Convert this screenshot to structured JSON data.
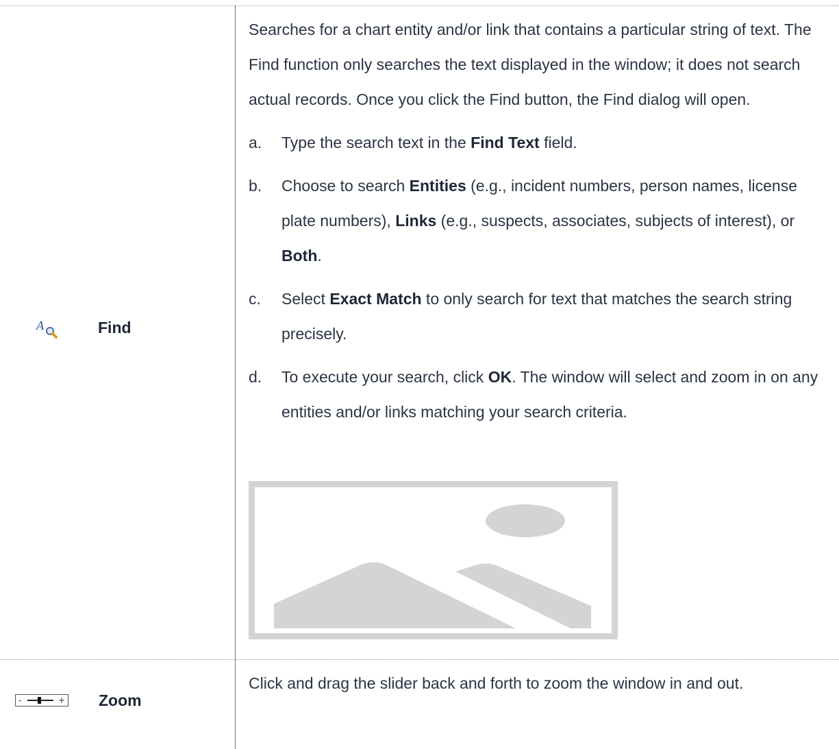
{
  "rows": [
    {
      "icon": "find-magnifier-icon",
      "label": "Find",
      "intro": "Searches for a chart entity and/or link that contains a particular string of text. The Find function only searches the text displayed in the window; it does not search actual records. Once you click the Find button, the Find dialog will open.",
      "steps": [
        {
          "marker": "a.",
          "parts": [
            {
              "t": "Type the search text in the ",
              "b": false
            },
            {
              "t": "Find Text",
              "b": true
            },
            {
              "t": " field.",
              "b": false
            }
          ]
        },
        {
          "marker": "b.",
          "parts": [
            {
              "t": "Choose to search ",
              "b": false
            },
            {
              "t": "Entities",
              "b": true
            },
            {
              "t": " (e.g., incident numbers, person names, license plate numbers), ",
              "b": false
            },
            {
              "t": "Links",
              "b": true
            },
            {
              "t": " (e.g., suspects, associates, subjects of interest), or ",
              "b": false
            },
            {
              "t": "Both",
              "b": true
            },
            {
              "t": ".",
              "b": false
            }
          ]
        },
        {
          "marker": "c.",
          "parts": [
            {
              "t": "Select ",
              "b": false
            },
            {
              "t": "Exact Match",
              "b": true
            },
            {
              "t": " to only search for text that matches the search string precisely.",
              "b": false
            }
          ]
        },
        {
          "marker": "d.",
          "parts": [
            {
              "t": "To execute your search, click ",
              "b": false
            },
            {
              "t": "OK",
              "b": true
            },
            {
              "t": ". The window will select and zoom in on any entities and/or links matching your search criteria.",
              "b": false
            }
          ]
        }
      ],
      "image": "image-placeholder-icon"
    },
    {
      "icon": "zoom-slider-icon",
      "label": "Zoom",
      "intro": "Click and drag the slider back and forth to zoom the window in and out."
    }
  ],
  "zoom_icon_text": {
    "minus": "-",
    "plus": "+"
  }
}
